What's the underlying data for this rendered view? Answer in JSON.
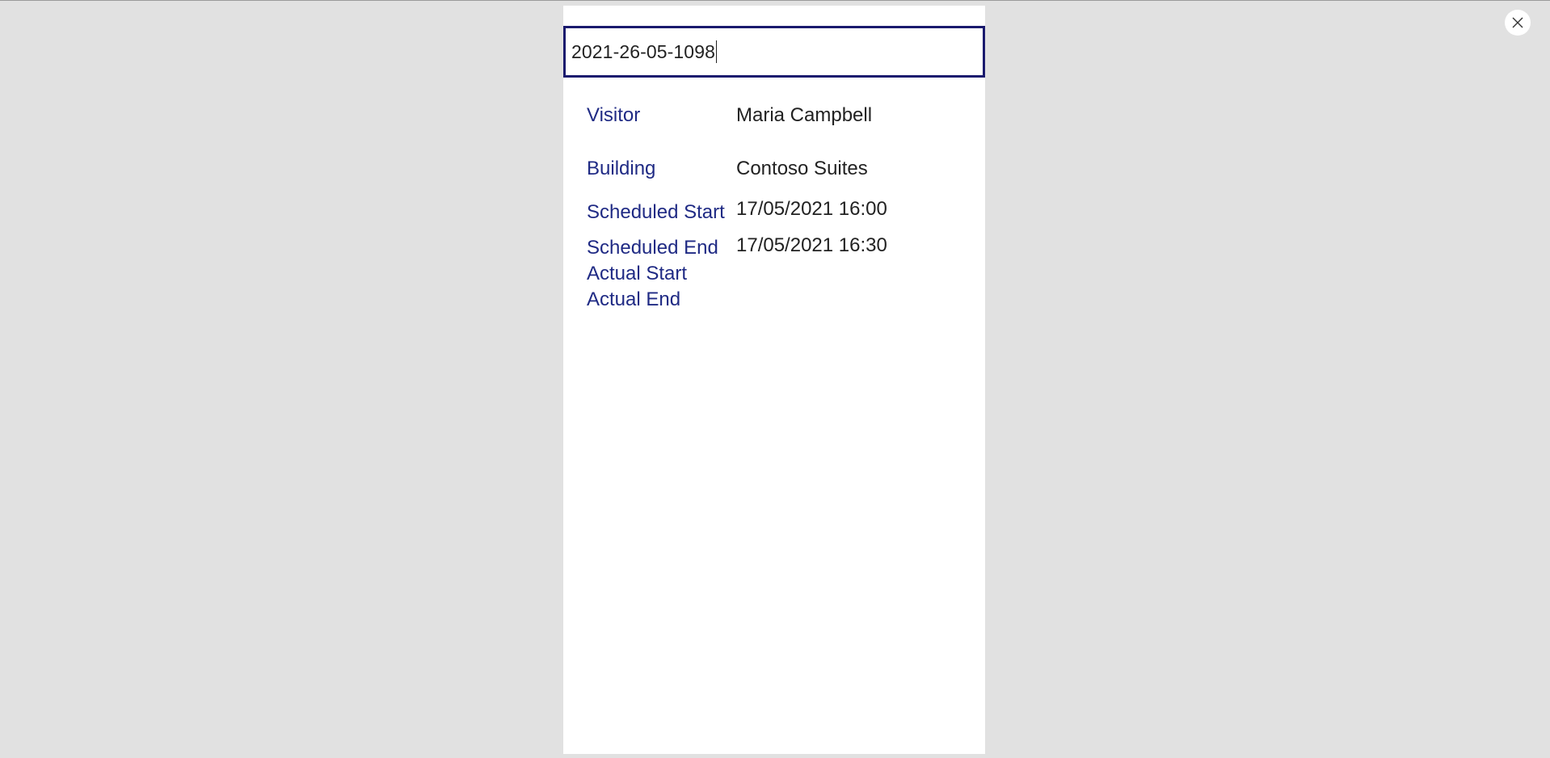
{
  "search": {
    "value": "2021-26-05-1098"
  },
  "details": {
    "visitor_label": "Visitor",
    "visitor_value": "Maria Campbell",
    "building_label": "Building",
    "building_value": "Contoso Suites",
    "scheduled_start_label": "Scheduled Start",
    "scheduled_start_value": "17/05/2021 16:00",
    "scheduled_end_label": "Scheduled End",
    "scheduled_end_value": "17/05/2021 16:30",
    "actual_start_label": "Actual Start",
    "actual_end_label": "Actual End"
  },
  "icons": {
    "close": "close-icon"
  },
  "colors": {
    "background": "#e1e1e1",
    "panel": "#ffffff",
    "label": "#1f2a84",
    "input_border": "#1a1a6e",
    "text": "#222222"
  }
}
